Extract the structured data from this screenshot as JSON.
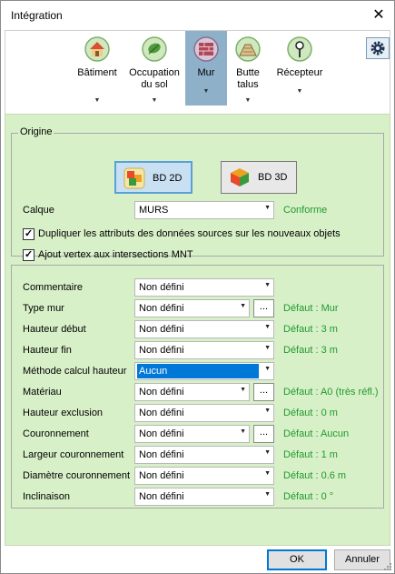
{
  "window": {
    "title": "Intégration",
    "close_glyph": "✕"
  },
  "toolbar": {
    "items": [
      {
        "id": "batiment",
        "label_line1": "Bâtiment",
        "label_line2": "",
        "icon": "building-icon"
      },
      {
        "id": "occupation",
        "label_line1": "Occupation",
        "label_line2": "du sol",
        "icon": "leaf-icon"
      },
      {
        "id": "mur",
        "label_line1": "Mur",
        "label_line2": "",
        "icon": "wall-icon",
        "active": true
      },
      {
        "id": "butte",
        "label_line1": "Butte",
        "label_line2": "talus",
        "icon": "embankment-icon"
      },
      {
        "id": "recepteur",
        "label_line1": "Récepteur",
        "label_line2": "",
        "icon": "receiver-icon"
      }
    ],
    "caret": "▼",
    "settings_icon": "gear-icon"
  },
  "origine": {
    "legend": "Origine",
    "bd2d_label": "BD 2D",
    "bd3d_label": "BD 3D",
    "calque_label": "Calque",
    "calque_value": "MURS",
    "calque_status": "Conforme",
    "check1_label": "Dupliquer les attributs des données sources sur les nouveaux objets",
    "check1_checked": true,
    "check2_label": "Ajout vertex aux intersections MNT",
    "check2_checked": true
  },
  "attributes": {
    "rows": [
      {
        "label": "Commentaire",
        "value": "Non défini",
        "has_dots": false,
        "default": ""
      },
      {
        "label": "Type mur",
        "value": "Non défini",
        "has_dots": true,
        "default": "Défaut : Mur"
      },
      {
        "label": "Hauteur début",
        "value": "Non défini",
        "has_dots": false,
        "default": "Défaut : 3 m"
      },
      {
        "label": "Hauteur fin",
        "value": "Non défini",
        "has_dots": false,
        "default": "Défaut : 3 m"
      },
      {
        "label": "Méthode calcul hauteur",
        "value": "Aucun",
        "has_dots": false,
        "default": "",
        "focused": true
      },
      {
        "label": "Matériau",
        "value": "Non défini",
        "has_dots": true,
        "default": "Défaut : A0 (très réfl.)"
      },
      {
        "label": "Hauteur exclusion",
        "value": "Non défini",
        "has_dots": false,
        "default": "Défaut : 0 m"
      },
      {
        "label": "Couronnement",
        "value": "Non défini",
        "has_dots": true,
        "default": "Défaut : Aucun"
      },
      {
        "label": "Largeur couronnement",
        "value": "Non défini",
        "has_dots": false,
        "default": "Défaut : 1 m"
      },
      {
        "label": "Diamètre couronnement",
        "value": "Non défini",
        "has_dots": false,
        "default": "Défaut : 0.6 m"
      },
      {
        "label": "Inclinaison",
        "value": "Non défini",
        "has_dots": false,
        "default": "Défaut : 0 °"
      }
    ],
    "dots_label": "...",
    "arrow": "▼"
  },
  "footer": {
    "ok_label": "OK",
    "cancel_label": "Annuler"
  },
  "colors": {
    "panel_bg": "#d8f0c8",
    "default_text": "#1f9a2e",
    "active_tab": "#8fb0c9",
    "selection": "#0078d7"
  }
}
